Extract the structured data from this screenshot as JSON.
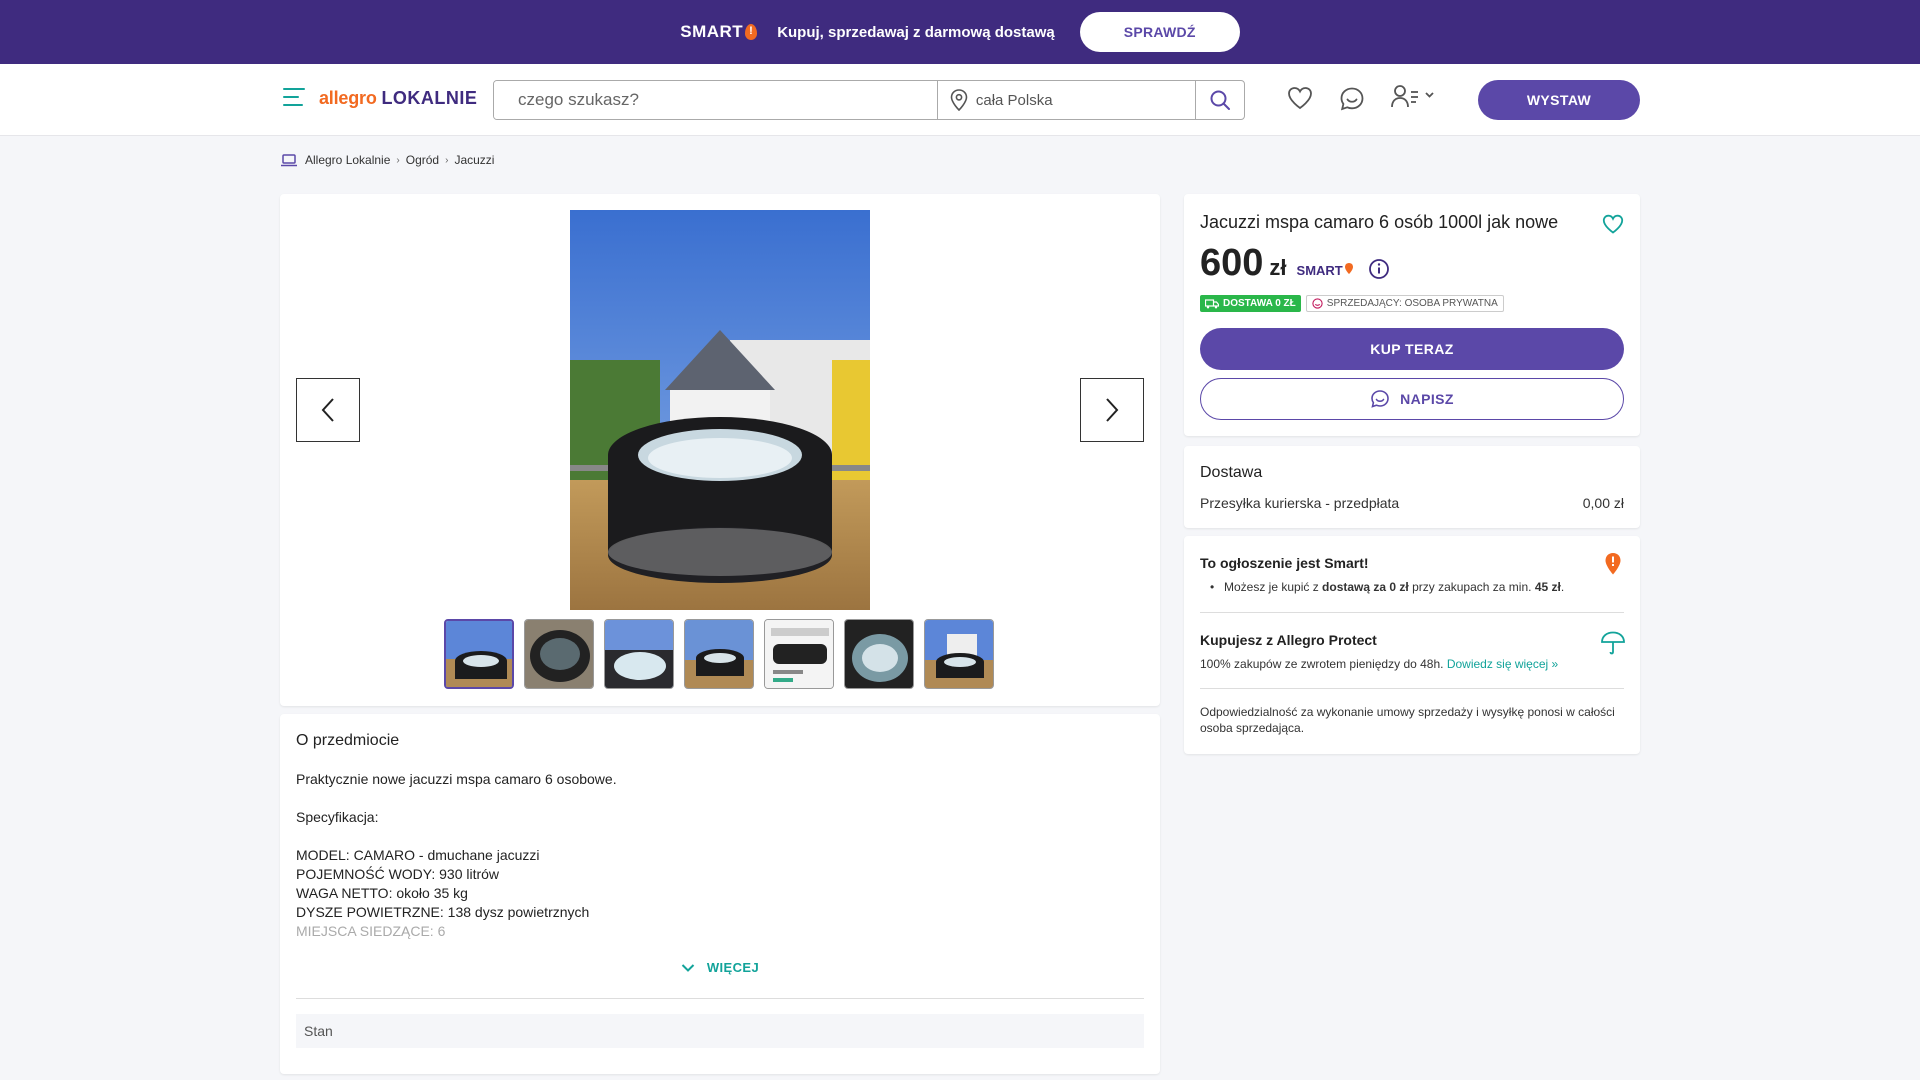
{
  "promo": {
    "smart_logo": "SMART",
    "text": "Kupuj, sprzedawaj z darmową dostawą",
    "button": "SPRAWDŹ"
  },
  "header": {
    "logo_part1": "allegro",
    "logo_part2": "LOKALNIE",
    "search_placeholder": "czego szukasz?",
    "location": "cała Polska",
    "post_button": "WYSTAW"
  },
  "breadcrumb": [
    "Allegro Lokalnie",
    "Ogród",
    "Jacuzzi"
  ],
  "listing": {
    "title": "Jacuzzi mspa camaro 6 osób 1000l jak nowe",
    "price": "600",
    "currency": "zł",
    "smart_label": "SMART",
    "badge_delivery": "DOSTAWA 0 ZŁ",
    "badge_seller": "SPRZEDAJĄCY: OSOBA PRYWATNA",
    "buy_button": "KUP TERAZ",
    "write_button": "NAPISZ"
  },
  "delivery": {
    "heading": "Dostawa",
    "method": "Przesyłka kurierska - przedpłata",
    "price": "0,00 zł"
  },
  "smart_info": {
    "heading": "To ogłoszenie jest Smart!",
    "item_pre": "Możesz je kupić z ",
    "item_bold": "dostawą za 0 zł",
    "item_mid": " przy zakupach za min. ",
    "item_amount": "45 zł",
    "item_end": ".",
    "protect_heading": "Kupujesz z Allegro Protect",
    "protect_text": "100% zakupów ze zwrotem pieniędzy do 48h. ",
    "protect_link": "Dowiedz się więcej »",
    "liability": "Odpowiedzialność za wykonanie umowy sprzedaży i wysyłkę ponosi w całości osoba sprzedająca."
  },
  "about": {
    "heading": "O przedmiocie",
    "line1": "Praktycznie nowe jacuzzi mspa camaro 6 osobowe.",
    "line2": "Specyfikacja:",
    "line3": "MODEL: CAMARO - dmuchane jacuzzi",
    "line4": "POJEMNOŚĆ WODY: 930 litrów",
    "line5": "WAGA NETTO: około 35 kg",
    "line6": "DYSZE POWIETRZNE: 138 dysz powietrznych",
    "line7": "MIEJSCA SIEDZĄCE: 6",
    "more": "WIĘCEJ",
    "stan_label": "Stan"
  },
  "gallery": {
    "thumb_count": 7,
    "active_thumb": 0
  },
  "colors": {
    "brand_purple": "#5b48a8",
    "banner": "#3f2b7f",
    "accent_orange": "#f26a21",
    "accent_teal": "#12a39a",
    "badge_green": "#2ab74a"
  }
}
